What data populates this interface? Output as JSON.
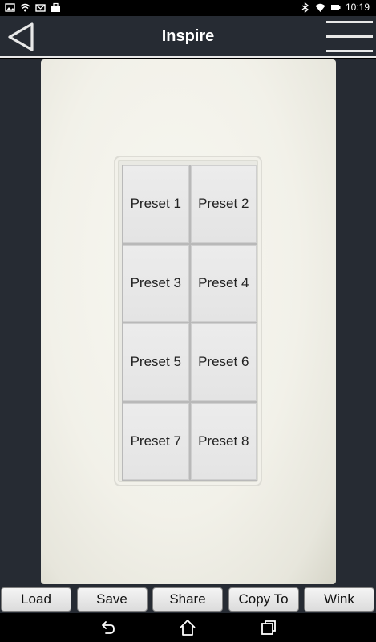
{
  "status_bar": {
    "time": "10:19",
    "left_icons": [
      "photo-icon",
      "wifi-alert-icon",
      "mail-icon",
      "briefcase-icon"
    ],
    "right_icons": [
      "bluetooth-icon",
      "wifi-icon",
      "battery-icon"
    ]
  },
  "header": {
    "title": "Inspire",
    "back_icon": "back-triangle-icon",
    "menu_icon": "hamburger-menu-icon"
  },
  "keypad": {
    "presets": [
      {
        "label": "Preset 1"
      },
      {
        "label": "Preset 2"
      },
      {
        "label": "Preset 3"
      },
      {
        "label": "Preset 4"
      },
      {
        "label": "Preset 5"
      },
      {
        "label": "Preset 6"
      },
      {
        "label": "Preset 7"
      },
      {
        "label": "Preset 8"
      }
    ]
  },
  "actions": {
    "load": "Load",
    "save": "Save",
    "share": "Share",
    "copy_to": "Copy To",
    "wink": "Wink"
  },
  "nav": {
    "back_icon": "nav-back-icon",
    "home_icon": "nav-home-icon",
    "recents_icon": "nav-recents-icon"
  },
  "colors": {
    "header_bg": "#262b33",
    "plate": "#f2f1e9",
    "button": "#e8e8e8"
  }
}
